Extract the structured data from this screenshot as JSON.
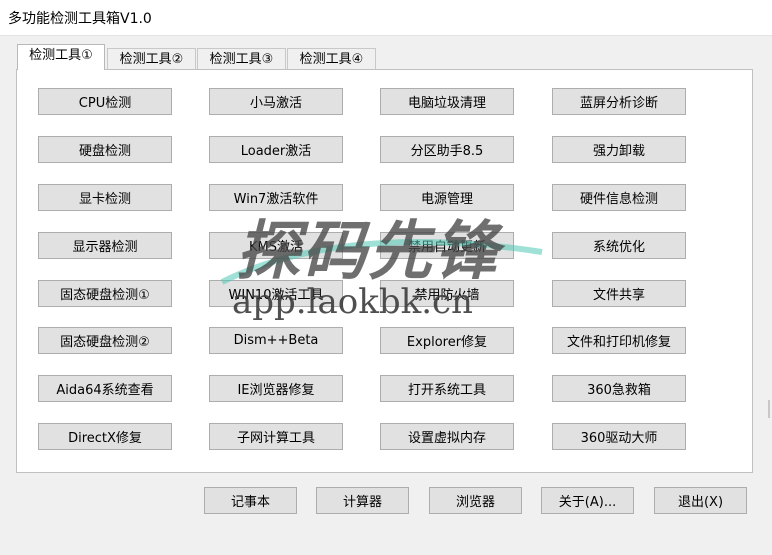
{
  "window": {
    "title": "多功能检测工具箱V1.0"
  },
  "tabs": [
    {
      "label": "检测工具①",
      "active": true
    },
    {
      "label": "检测工具②",
      "active": false
    },
    {
      "label": "检测工具③",
      "active": false
    },
    {
      "label": "检测工具④",
      "active": false
    }
  ],
  "grid_buttons": [
    [
      "CPU检测",
      "小马激活",
      "电脑垃圾清理",
      "蓝屏分析诊断"
    ],
    [
      "硬盘检测",
      "Loader激活",
      "分区助手8.5",
      "强力卸载"
    ],
    [
      "显卡检测",
      "Win7激活软件",
      "电源管理",
      "硬件信息检测"
    ],
    [
      "显示器检测",
      "KMS激活",
      "禁用自动更新",
      "系统优化"
    ],
    [
      "固态硬盘检测①",
      "WIN10激活工具",
      "禁用防火墙",
      "文件共享"
    ],
    [
      "固态硬盘检测②",
      "Dism++Beta",
      "Explorer修复",
      "文件和打印机修复"
    ],
    [
      "Aida64系统查看",
      "IE浏览器修复",
      "打开系统工具",
      "360急救箱"
    ],
    [
      "DirectX修复",
      "子网计算工具",
      "设置虚拟内存",
      "360驱动大师"
    ]
  ],
  "bottom_buttons": [
    "记事本",
    "计算器",
    "浏览器",
    "关于(A)...",
    "退出(X)"
  ],
  "watermark": {
    "brand": "探码先锋",
    "url": "app.laokbk.cn"
  }
}
